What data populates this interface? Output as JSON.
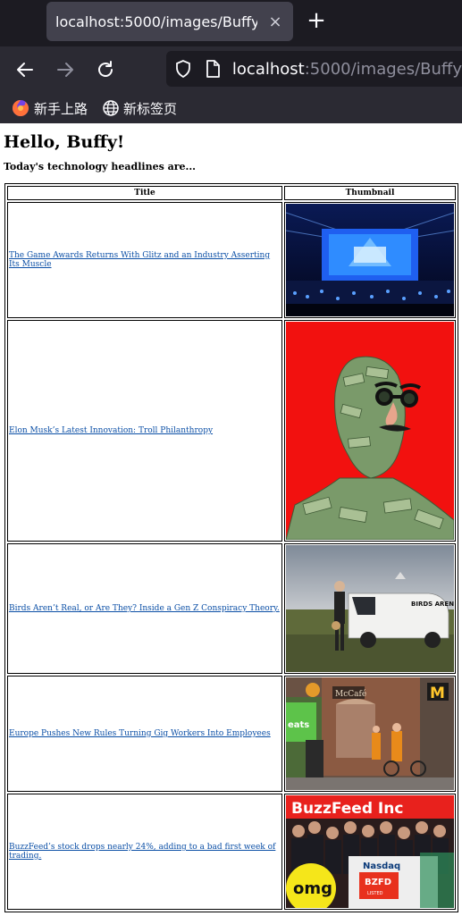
{
  "browser": {
    "tab_title": "localhost:5000/images/Buffy",
    "tab_close": "×",
    "new_tab": "+",
    "url_host": "localhost",
    "url_rest": ":5000/images/Buffy",
    "bookmarks": [
      {
        "label": "新手上路",
        "icon": "firefox-icon"
      },
      {
        "label": "新标签页",
        "icon": "globe-icon"
      }
    ]
  },
  "page": {
    "heading": "Hello, Buffy!",
    "subtitle": "Today's technology headlines are...",
    "columns": [
      "Title",
      "Thumbnail"
    ],
    "rows": [
      {
        "title": "The Game Awards Returns With Glitz and an Industry Asserting Its Muscle",
        "thumb": "game-awards-stage-photo"
      },
      {
        "title": "Elon Musk’s Latest Innovation: Troll Philanthropy",
        "thumb": "money-head-disguise-photo"
      },
      {
        "title": "Birds Aren’t Real, or Are They? Inside a Gen Z Conspiracy Theory.",
        "thumb": "birds-arent-real-van-photo"
      },
      {
        "title": "Europe Pushes New Rules Turning Gig Workers Into Employees",
        "thumb": "delivery-workers-photo"
      },
      {
        "title": "BuzzFeed’s stock drops nearly 24%, adding to a bad first week of trading.",
        "thumb": "buzzfeed-nasdaq-photo"
      }
    ]
  },
  "thumbnails": {
    "van_text": "BIRDS ARENT REAL",
    "shop_left": "McCafé",
    "shop_right": "M",
    "side_text": "eats",
    "bf_brand": "BuzzFeed Inc",
    "bf_exchange": "Nasdaq",
    "bf_ticker": "BZFD",
    "bf_sub": "LISTED",
    "bf_omg": "omg"
  }
}
